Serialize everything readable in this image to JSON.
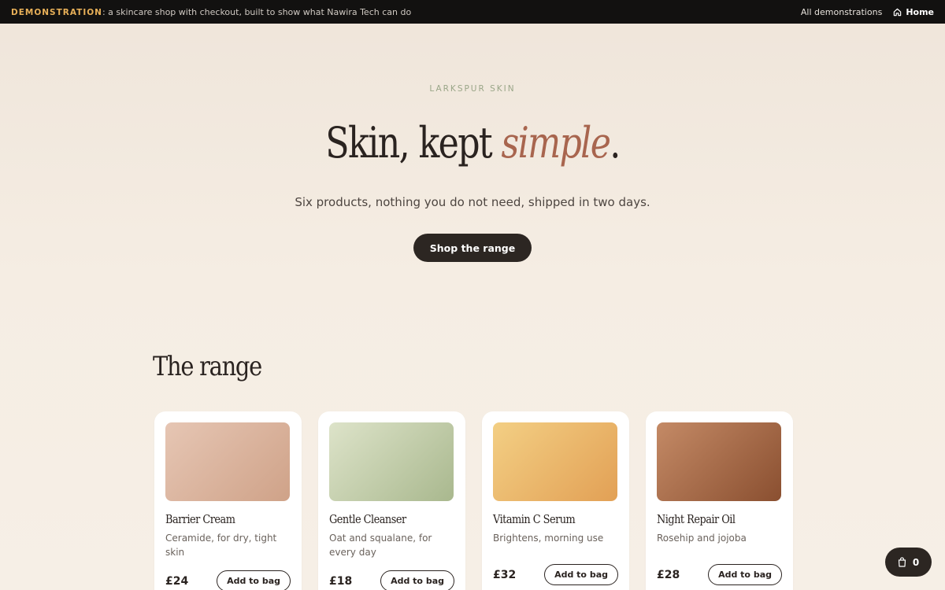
{
  "topbar": {
    "demo_tag": "DEMONSTRATION",
    "demo_desc": ": a skincare shop with checkout, built to show what Nawira Tech can do",
    "all_demos": "All demonstrations",
    "home": "Home"
  },
  "hero": {
    "brand": "LARKSPUR SKIN",
    "title_start": "Skin, kept ",
    "title_accent": "simple",
    "title_end": ".",
    "subtitle": "Six products, nothing you do not need, shipped in two days.",
    "cta": "Shop the range"
  },
  "range": {
    "title": "The range",
    "products": [
      {
        "name": "Barrier Cream",
        "desc": "Ceramide, for dry, tight skin",
        "price": "£24",
        "button": "Add to bag",
        "swatch_from": "#e6c6b4",
        "swatch_to": "#cfa288"
      },
      {
        "name": "Gentle Cleanser",
        "desc": "Oat and squalane, for every day",
        "price": "£18",
        "button": "Add to bag",
        "swatch_from": "#dde3c9",
        "swatch_to": "#a9b88e"
      },
      {
        "name": "Vitamin C Serum",
        "desc": "Brightens, morning use",
        "price": "£32",
        "button": "Add to bag",
        "swatch_from": "#f3cf84",
        "swatch_to": "#e2a055"
      },
      {
        "name": "Night Repair Oil",
        "desc": "Rosehip and jojoba",
        "price": "£28",
        "button": "Add to bag",
        "swatch_from": "#c48a66",
        "swatch_to": "#8a4f30"
      }
    ]
  },
  "bag": {
    "count": "0"
  },
  "colors": {
    "accent": "#a8654e",
    "dark": "#2c2622",
    "demo_tag": "#e8b058"
  }
}
